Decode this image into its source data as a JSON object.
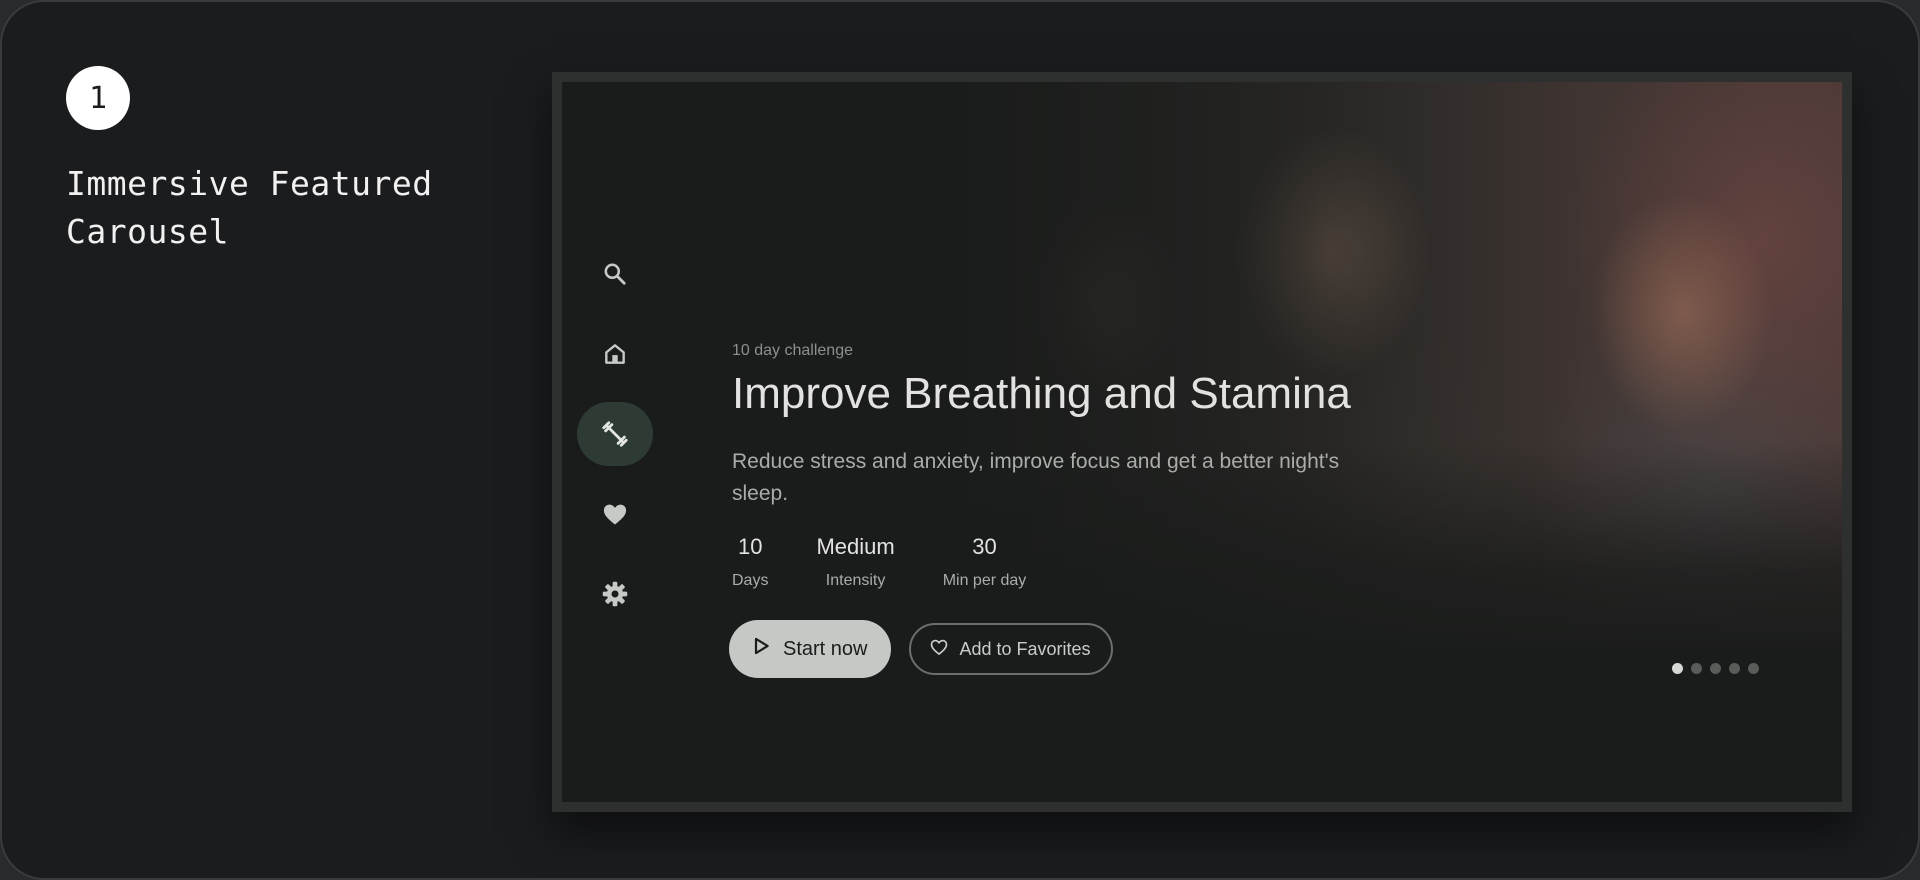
{
  "annotation": {
    "step_number": "1",
    "title": "Immersive Featured Carousel"
  },
  "nav": {
    "items": [
      {
        "name": "search",
        "icon": "search-icon",
        "active": false
      },
      {
        "name": "home",
        "icon": "home-icon",
        "active": false
      },
      {
        "name": "workouts",
        "icon": "dumbbell-icon",
        "active": true
      },
      {
        "name": "favorites",
        "icon": "heart-icon",
        "active": false
      },
      {
        "name": "settings",
        "icon": "gear-icon",
        "active": false
      }
    ]
  },
  "featured": {
    "eyebrow": "10 day challenge",
    "title": "Improve Breathing and Stamina",
    "description": "Reduce stress and anxiety, improve focus and get a better night's sleep.",
    "stats": [
      {
        "value": "10",
        "label": "Days"
      },
      {
        "value": "Medium",
        "label": "Intensity"
      },
      {
        "value": "30",
        "label": "Min per day"
      }
    ],
    "primary_action": {
      "label": "Start now",
      "icon": "play-icon"
    },
    "secondary_action": {
      "label": "Add to Favorites",
      "icon": "heart-outline-icon"
    }
  },
  "pager": {
    "count": 5,
    "active_index": 0
  },
  "colors": {
    "background": "#1b1c1e",
    "screen": "#1a1c1b",
    "active_nav": "#2e3b35",
    "primary_button": "#c6c8c5"
  }
}
